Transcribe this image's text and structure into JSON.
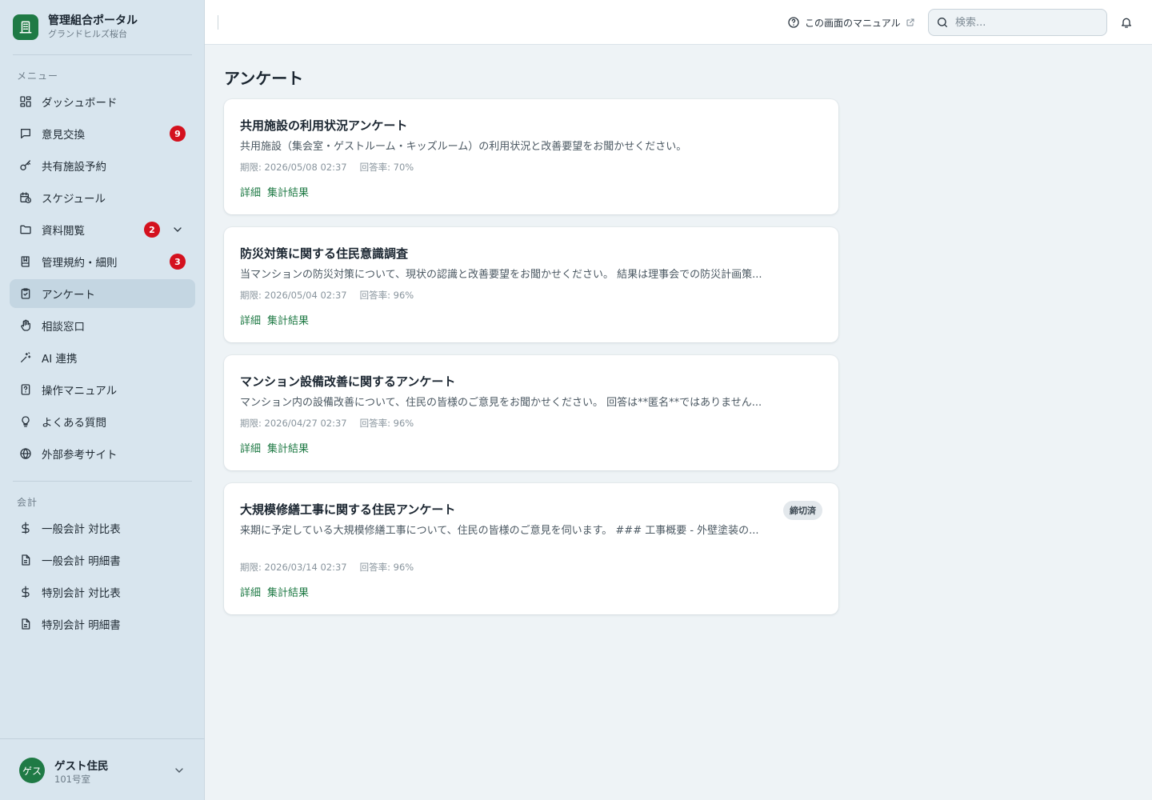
{
  "app": {
    "title": "管理組合ポータル",
    "subtitle": "グランドヒルズ桜台"
  },
  "sidebar": {
    "menu_label": "メニュー",
    "items": [
      {
        "label": "ダッシュボード",
        "icon": "dashboard-icon"
      },
      {
        "label": "意見交換",
        "icon": "chat-icon",
        "badge": "9"
      },
      {
        "label": "共有施設予約",
        "icon": "key-icon"
      },
      {
        "label": "スケジュール",
        "icon": "calendar-clock-icon"
      },
      {
        "label": "資料閲覧",
        "icon": "folder-icon",
        "badge": "2"
      },
      {
        "label": "管理規約・細則",
        "icon": "book-icon",
        "badge": "3"
      },
      {
        "label": "アンケート",
        "icon": "clipboard-icon"
      },
      {
        "label": "相談窓口",
        "icon": "hand-icon"
      },
      {
        "label": "AI 連携",
        "icon": "sparkle-icon"
      },
      {
        "label": "操作マニュアル",
        "icon": "manual-icon"
      },
      {
        "label": "よくある質問",
        "icon": "lightbulb-icon"
      },
      {
        "label": "外部参考サイト",
        "icon": "globe-icon"
      }
    ],
    "accounting_label": "会計",
    "accounting_items": [
      {
        "label": "一般会計 対比表",
        "icon": "dollar-icon"
      },
      {
        "label": "一般会計 明細書",
        "icon": "document-icon"
      },
      {
        "label": "特別会計 対比表",
        "icon": "dollar-icon"
      },
      {
        "label": "特別会計 明細書",
        "icon": "document-icon"
      }
    ]
  },
  "user": {
    "avatar": "ゲス",
    "name": "ゲスト住民",
    "room": "101号室"
  },
  "header": {
    "manual_link": "この画面のマニュアル",
    "search_placeholder": "検索..."
  },
  "main": {
    "title": "アンケート",
    "surveys": [
      {
        "title": "共用施設の利用状況アンケート",
        "description": "共用施設（集会室・ゲストルーム・キッズルーム）の利用状況と改善要望をお聞かせください。",
        "deadline": "期限: 2026/05/08 02:37",
        "response_rate": "回答率: 70%",
        "detail_link": "詳細",
        "results_link": "集計結果"
      },
      {
        "title": "防災対策に関する住民意識調査",
        "description": "当マンションの防災対策について、現状の認識と改善要望をお聞かせください。 結果は理事会での防災計画策...",
        "deadline": "期限: 2026/05/04 02:37",
        "response_rate": "回答率: 96%",
        "detail_link": "詳細",
        "results_link": "集計結果"
      },
      {
        "title": "マンション設備改善に関するアンケート",
        "description": "マンション内の設備改善について、住民の皆様のご意見をお聞かせください。 回答は**匿名**ではありません...",
        "deadline": "期限: 2026/04/27 02:37",
        "response_rate": "回答率: 96%",
        "detail_link": "詳細",
        "results_link": "集計結果"
      },
      {
        "title": "大規模修繕工事に関する住民アンケート",
        "description": "来期に予定している大規模修繕工事について、住民の皆様のご意見を伺います。 ### 工事概要 - 外壁塗装の...",
        "deadline": "期限: 2026/03/14 02:37",
        "response_rate": "回答率: 96%",
        "detail_link": "詳細",
        "results_link": "集計結果",
        "status": "締切済"
      }
    ]
  },
  "colors": {
    "accent": "#1f7a45",
    "badge": "#d4111e",
    "sidebar_bg": "#d8e5ee",
    "page_bg": "#eef3f6"
  }
}
